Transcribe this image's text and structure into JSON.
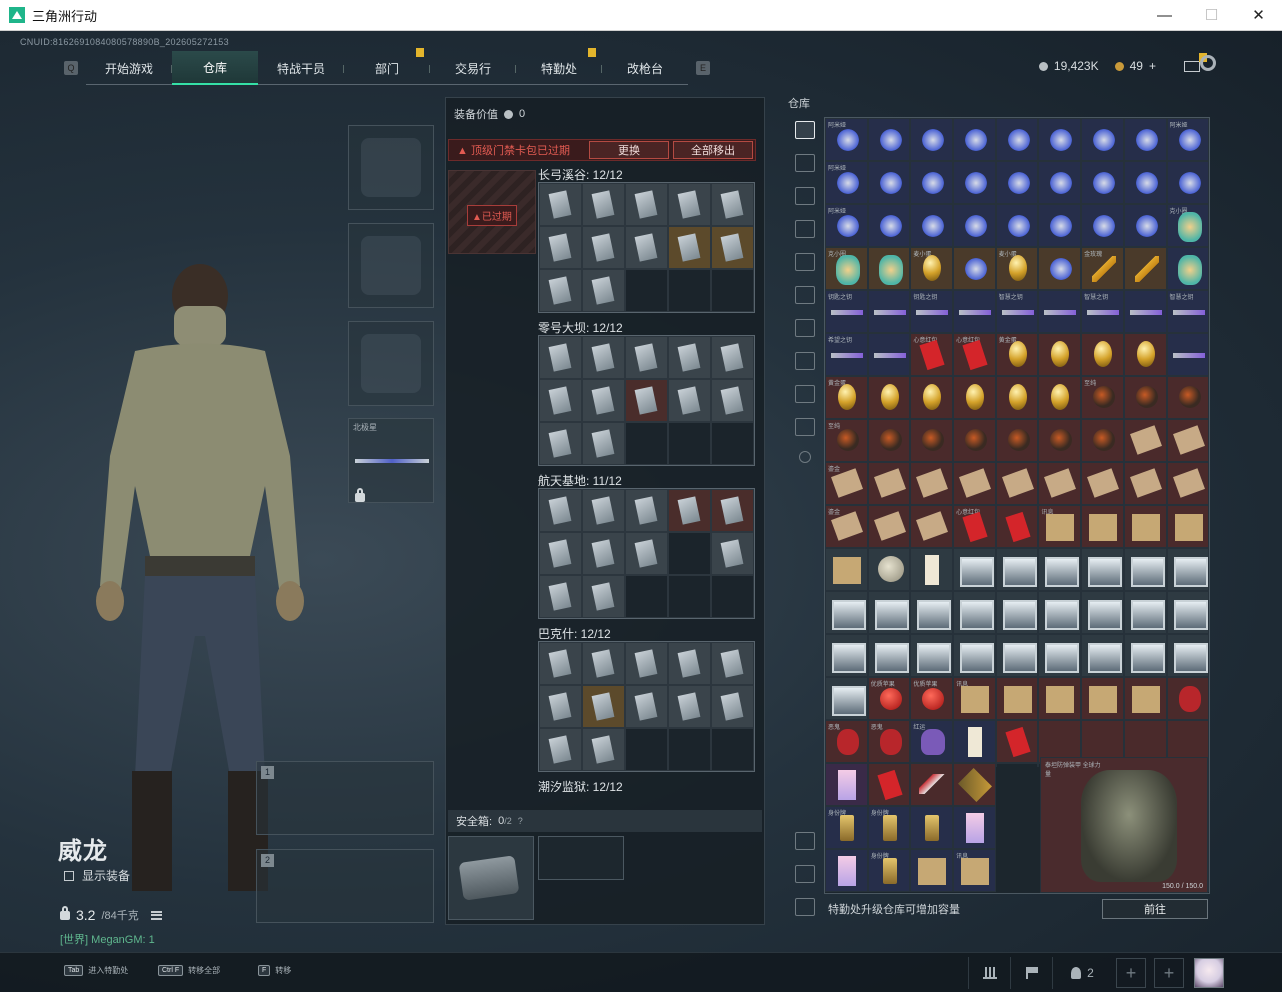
{
  "window": {
    "title": "三角洲行动",
    "buttons": [
      "—",
      "☐",
      "✕"
    ]
  },
  "uid": "CNUID:8162691084080578890B_202605272153",
  "nav": {
    "left_key": "Q",
    "right_key": "E",
    "tabs": [
      {
        "label": "开始游戏",
        "active": false,
        "badge": false
      },
      {
        "label": "仓库",
        "active": true,
        "badge": false
      },
      {
        "label": "特战干员",
        "active": false,
        "badge": false
      },
      {
        "label": "部门",
        "active": false,
        "badge": true
      },
      {
        "label": "交易行",
        "active": false,
        "badge": false
      },
      {
        "label": "特勤处",
        "active": false,
        "badge": true
      },
      {
        "label": "改枪台",
        "active": false,
        "badge": false
      }
    ]
  },
  "currency": {
    "silver": "19,423K",
    "gold": "49",
    "plus": "+"
  },
  "character": {
    "name": "威龙",
    "show_equipment": "显示装备",
    "weight": "3.2",
    "weight_max": "/84千克",
    "world": "[世界] MeganGM: 1",
    "melee_label": "北极星",
    "weapon_slots": [
      "1",
      "2"
    ]
  },
  "equipment_panel": {
    "value_label": "装备价值",
    "value": "0",
    "warning": "▲ 顶级门禁卡包已过期",
    "replace_button": "更换",
    "remove_all_button": "全部移出",
    "expired_tag": "▲已过期",
    "groups": [
      {
        "title": "长弓溪谷: 12/12"
      },
      {
        "title": "零号大坝: 12/12"
      },
      {
        "title": "航天基地: 11/12"
      },
      {
        "title": "巴克什: 12/12"
      },
      {
        "title": "潮汐监狱: 12/12"
      }
    ],
    "safe_label": "安全箱:",
    "safe_value": "0",
    "safe_max": "/2",
    "safe_help": "?"
  },
  "warehouse": {
    "title": "仓库",
    "footer_text": "特勤处升级仓库可增加容量",
    "goto_button": "前往",
    "armor_caption": "泰坦防弹装甲 全球力量",
    "armor_durability": "150.0 / 150.0",
    "items": [
      {
        "c": "阿米娅",
        "t": "bunny",
        "b": "bg-b"
      },
      {
        "c": "",
        "t": "bunny",
        "b": "bg-b"
      },
      {
        "c": "",
        "t": "bunny",
        "b": "bg-b"
      },
      {
        "c": "",
        "t": "bunny",
        "b": "bg-b"
      },
      {
        "c": "",
        "t": "bunny",
        "b": "bg-b"
      },
      {
        "c": "",
        "t": "bunny",
        "b": "bg-b"
      },
      {
        "c": "",
        "t": "bunny",
        "b": "bg-b"
      },
      {
        "c": "",
        "t": "bunny",
        "b": "bg-b"
      },
      {
        "c": "阿米娅",
        "t": "bunny",
        "b": "bg-b"
      },
      {
        "c": "阿米娅",
        "t": "bunny",
        "b": "bg-b"
      },
      {
        "c": "",
        "t": "bunny",
        "b": "bg-b"
      },
      {
        "c": "",
        "t": "bunny",
        "b": "bg-b"
      },
      {
        "c": "",
        "t": "bunny",
        "b": "bg-b"
      },
      {
        "c": "",
        "t": "bunny",
        "b": "bg-b"
      },
      {
        "c": "",
        "t": "bunny",
        "b": "bg-b"
      },
      {
        "c": "",
        "t": "bunny",
        "b": "bg-b"
      },
      {
        "c": "",
        "t": "bunny",
        "b": "bg-b"
      },
      {
        "c": "",
        "t": "bunny",
        "b": "bg-b"
      },
      {
        "c": "阿米娅",
        "t": "bunny",
        "b": "bg-b"
      },
      {
        "c": "",
        "t": "bunny",
        "b": "bg-b"
      },
      {
        "c": "",
        "t": "bunny",
        "b": "bg-b"
      },
      {
        "c": "",
        "t": "bunny",
        "b": "bg-b"
      },
      {
        "c": "",
        "t": "bunny",
        "b": "bg-b"
      },
      {
        "c": "",
        "t": "bunny",
        "b": "bg-b"
      },
      {
        "c": "",
        "t": "bunny",
        "b": "bg-b"
      },
      {
        "c": "",
        "t": "bunny",
        "b": "bg-b"
      },
      {
        "c": "克小圈",
        "t": "doll",
        "b": "bg-b"
      },
      {
        "c": "克小圈",
        "t": "doll",
        "b": "bg-o"
      },
      {
        "c": "",
        "t": "doll",
        "b": "bg-o"
      },
      {
        "c": "麦小蛋",
        "t": "egg",
        "b": "bg-o"
      },
      {
        "c": "",
        "t": "bunny",
        "b": "bg-o"
      },
      {
        "c": "麦小蛋",
        "t": "egg",
        "b": "bg-o"
      },
      {
        "c": "",
        "t": "bunny",
        "b": "bg-o"
      },
      {
        "c": "金玫瑰",
        "t": "rose",
        "b": "bg-o"
      },
      {
        "c": "",
        "t": "rose",
        "b": "bg-o"
      },
      {
        "c": "",
        "t": "doll",
        "b": "bg-b"
      },
      {
        "c": "钥匙之钥",
        "t": "key",
        "b": "bg-b"
      },
      {
        "c": "",
        "t": "key",
        "b": "bg-b"
      },
      {
        "c": "钥匙之钥",
        "t": "key",
        "b": "bg-b"
      },
      {
        "c": "",
        "t": "key",
        "b": "bg-b"
      },
      {
        "c": "智慧之钥",
        "t": "key",
        "b": "bg-b"
      },
      {
        "c": "",
        "t": "key",
        "b": "bg-b"
      },
      {
        "c": "智慧之钥",
        "t": "key",
        "b": "bg-b"
      },
      {
        "c": "",
        "t": "key",
        "b": "bg-b"
      },
      {
        "c": "智慧之钥",
        "t": "key",
        "b": "bg-b"
      },
      {
        "c": "希望之钥",
        "t": "key",
        "b": "bg-b"
      },
      {
        "c": "",
        "t": "key",
        "b": "bg-b"
      },
      {
        "c": "心意红包",
        "t": "redenv",
        "b": "bg-r"
      },
      {
        "c": "心意红包",
        "t": "redenv",
        "b": "bg-r"
      },
      {
        "c": "黄金蛋",
        "t": "egg",
        "b": "bg-r"
      },
      {
        "c": "",
        "t": "egg",
        "b": "bg-r"
      },
      {
        "c": "",
        "t": "egg",
        "b": "bg-r"
      },
      {
        "c": "",
        "t": "egg",
        "b": "bg-r"
      },
      {
        "c": "",
        "t": "key",
        "b": "bg-b"
      },
      {
        "c": "黄金蛋",
        "t": "egg",
        "b": "bg-r"
      },
      {
        "c": "",
        "t": "egg",
        "b": "bg-r"
      },
      {
        "c": "",
        "t": "egg",
        "b": "bg-r"
      },
      {
        "c": "",
        "t": "egg",
        "b": "bg-r"
      },
      {
        "c": "",
        "t": "egg",
        "b": "bg-r"
      },
      {
        "c": "",
        "t": "egg",
        "b": "bg-r"
      },
      {
        "c": "至纯",
        "t": "bomb",
        "b": "bg-r"
      },
      {
        "c": "",
        "t": "bomb",
        "b": "bg-r"
      },
      {
        "c": "",
        "t": "bomb",
        "b": "bg-r"
      },
      {
        "c": "至纯",
        "t": "bomb",
        "b": "bg-r"
      },
      {
        "c": "",
        "t": "bomb",
        "b": "bg-r"
      },
      {
        "c": "",
        "t": "bomb",
        "b": "bg-r"
      },
      {
        "c": "",
        "t": "bomb",
        "b": "bg-r"
      },
      {
        "c": "",
        "t": "bomb",
        "b": "bg-r"
      },
      {
        "c": "",
        "t": "bomb",
        "b": "bg-r"
      },
      {
        "c": "",
        "t": "bomb",
        "b": "bg-r"
      },
      {
        "c": "",
        "t": "map",
        "b": "bg-r"
      },
      {
        "c": "",
        "t": "map",
        "b": "bg-r"
      },
      {
        "c": "鎏金",
        "t": "map",
        "b": "bg-r"
      },
      {
        "c": "",
        "t": "map",
        "b": "bg-r"
      },
      {
        "c": "",
        "t": "map",
        "b": "bg-r"
      },
      {
        "c": "",
        "t": "map",
        "b": "bg-r"
      },
      {
        "c": "",
        "t": "map",
        "b": "bg-r"
      },
      {
        "c": "",
        "t": "map",
        "b": "bg-r"
      },
      {
        "c": "",
        "t": "map",
        "b": "bg-r"
      },
      {
        "c": "",
        "t": "map",
        "b": "bg-r"
      },
      {
        "c": "",
        "t": "map",
        "b": "bg-r"
      },
      {
        "c": "鎏金",
        "t": "map",
        "b": "bg-r"
      },
      {
        "c": "",
        "t": "map",
        "b": "bg-r"
      },
      {
        "c": "",
        "t": "map",
        "b": "bg-r"
      },
      {
        "c": "心意红包",
        "t": "redenv",
        "b": "bg-r"
      },
      {
        "c": "",
        "t": "redenv",
        "b": "bg-r"
      },
      {
        "c": "讯息",
        "t": "parch",
        "b": "bg-r"
      },
      {
        "c": "",
        "t": "parch",
        "b": "bg-r"
      },
      {
        "c": "",
        "t": "parch",
        "b": "bg-r"
      },
      {
        "c": "",
        "t": "parch",
        "b": "bg-r"
      },
      {
        "c": "",
        "t": "parch",
        "b": "bg-g"
      },
      {
        "c": "",
        "t": "moon",
        "b": "bg-g"
      },
      {
        "c": "",
        "t": "paper",
        "b": "bg-g"
      },
      {
        "c": "",
        "t": "photo",
        "b": "bg-g"
      },
      {
        "c": "",
        "t": "photo",
        "b": "bg-g"
      },
      {
        "c": "",
        "t": "photo",
        "b": "bg-g"
      },
      {
        "c": "",
        "t": "photo",
        "b": "bg-g"
      },
      {
        "c": "",
        "t": "photo",
        "b": "bg-g"
      },
      {
        "c": "",
        "t": "photo",
        "b": "bg-g"
      },
      {
        "c": "",
        "t": "photo",
        "b": "bg-g"
      },
      {
        "c": "",
        "t": "photo",
        "b": "bg-g"
      },
      {
        "c": "",
        "t": "photo",
        "b": "bg-g"
      },
      {
        "c": "",
        "t": "photo",
        "b": "bg-g"
      },
      {
        "c": "",
        "t": "photo",
        "b": "bg-g"
      },
      {
        "c": "",
        "t": "photo",
        "b": "bg-g"
      },
      {
        "c": "",
        "t": "photo",
        "b": "bg-g"
      },
      {
        "c": "",
        "t": "photo",
        "b": "bg-g"
      },
      {
        "c": "",
        "t": "photo",
        "b": "bg-g"
      },
      {
        "c": "",
        "t": "photo",
        "b": "bg-g"
      },
      {
        "c": "",
        "t": "photo",
        "b": "bg-g"
      },
      {
        "c": "",
        "t": "photo",
        "b": "bg-g"
      },
      {
        "c": "",
        "t": "photo",
        "b": "bg-g"
      },
      {
        "c": "",
        "t": "photo",
        "b": "bg-g"
      },
      {
        "c": "",
        "t": "photo",
        "b": "bg-g"
      },
      {
        "c": "",
        "t": "photo",
        "b": "bg-g"
      },
      {
        "c": "",
        "t": "photo",
        "b": "bg-g"
      },
      {
        "c": "",
        "t": "photo",
        "b": "bg-g"
      },
      {
        "c": "",
        "t": "photo",
        "b": "bg-g"
      },
      {
        "c": "优质苹果",
        "t": "apple",
        "b": "bg-r"
      },
      {
        "c": "优质苹果",
        "t": "apple",
        "b": "bg-r"
      },
      {
        "c": "讯息",
        "t": "parch",
        "b": "bg-r"
      },
      {
        "c": "",
        "t": "parch",
        "b": "bg-r"
      },
      {
        "c": "",
        "t": "parch",
        "b": "bg-r"
      },
      {
        "c": "",
        "t": "parch",
        "b": "bg-r"
      },
      {
        "c": "",
        "t": "parch",
        "b": "bg-r"
      },
      {
        "c": "",
        "t": "mask",
        "b": "bg-r"
      },
      {
        "c": "恶鬼",
        "t": "mask",
        "b": "bg-r"
      },
      {
        "c": "恶鬼",
        "t": "mask",
        "b": "bg-r"
      },
      {
        "c": "红运",
        "t": "pouch",
        "b": "bg-b"
      },
      {
        "c": "",
        "t": "paper",
        "b": "bg-b"
      },
      {
        "c": "",
        "t": "redenv",
        "b": "bg-r"
      },
      {
        "c": "",
        "t": "n",
        "b": "bg-r"
      },
      {
        "c": "",
        "t": "n",
        "b": "bg-r"
      },
      {
        "c": "",
        "t": "n",
        "b": "bg-r"
      },
      {
        "c": "",
        "t": "n",
        "b": "bg-r"
      },
      {
        "c": "",
        "t": "card",
        "b": "bg-p"
      },
      {
        "c": "",
        "t": "redenv",
        "b": "bg-r"
      },
      {
        "c": "",
        "t": "arrow",
        "b": "bg-r"
      },
      {
        "c": "",
        "t": "shard",
        "b": "bg-r"
      },
      {
        "c": "",
        "t": "n",
        "b": "bg-n"
      },
      {
        "c": "",
        "t": "n",
        "b": "bg-n"
      },
      {
        "c": "",
        "t": "n",
        "b": "bg-n"
      },
      {
        "c": "",
        "t": "n",
        "b": "bg-n"
      },
      {
        "c": "",
        "t": "n",
        "b": "bg-n"
      },
      {
        "c": "身份牌",
        "t": "tag",
        "b": "bg-b"
      },
      {
        "c": "身份牌",
        "t": "tag",
        "b": "bg-b"
      },
      {
        "c": "",
        "t": "tag",
        "b": "bg-b"
      },
      {
        "c": "",
        "t": "card",
        "b": "bg-b"
      },
      {
        "c": "",
        "t": "n",
        "b": "bg-n"
      },
      {
        "c": "",
        "t": "n",
        "b": "bg-n"
      },
      {
        "c": "",
        "t": "n",
        "b": "bg-n"
      },
      {
        "c": "",
        "t": "n",
        "b": "bg-n"
      },
      {
        "c": "",
        "t": "n",
        "b": "bg-n"
      },
      {
        "c": "",
        "t": "card",
        "b": "bg-b"
      },
      {
        "c": "身份牌",
        "t": "tag",
        "b": "bg-b"
      },
      {
        "c": "",
        "t": "parch",
        "b": "bg-b"
      },
      {
        "c": "讯息",
        "t": "parch",
        "b": "bg-b"
      },
      {
        "c": "",
        "t": "n",
        "b": "bg-n"
      },
      {
        "c": "",
        "t": "n",
        "b": "bg-n"
      },
      {
        "c": "",
        "t": "n",
        "b": "bg-n"
      },
      {
        "c": "",
        "t": "n",
        "b": "bg-n"
      },
      {
        "c": "",
        "t": "n",
        "b": "bg-n"
      }
    ]
  },
  "bottom": {
    "hotkeys": [
      {
        "key": "Tab",
        "label": "进入特勤处"
      },
      {
        "key": "Ctrl F",
        "label": "转移全部"
      },
      {
        "key": "F",
        "label": "转移"
      }
    ],
    "friends": "2"
  },
  "colors": {
    "accent": "#35e0a6",
    "warning": "#e25b52",
    "badge": "#e3b52c"
  }
}
